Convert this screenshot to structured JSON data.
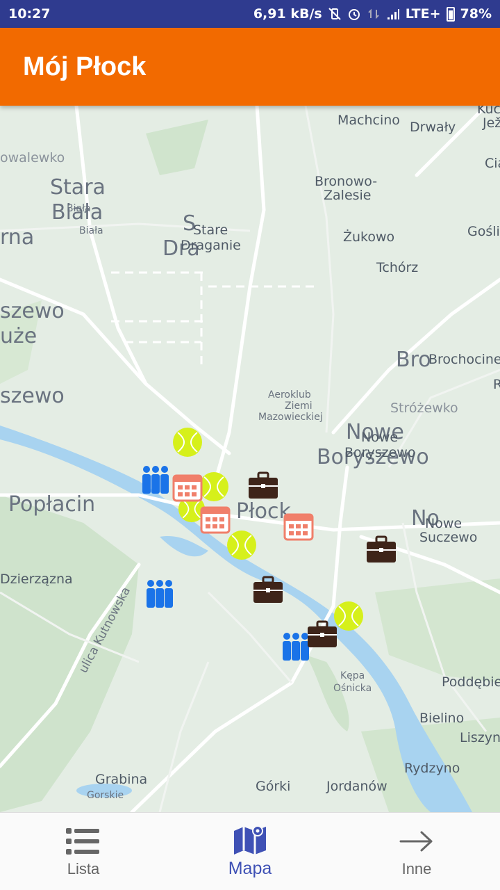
{
  "status_bar": {
    "time": "10:27",
    "speed": "6,91 kB/s",
    "network": "LTE+",
    "battery": "78%"
  },
  "app_bar": {
    "title": "Mój Płock"
  },
  "map": {
    "places": {
      "machcino": "Machcino",
      "drwaly": "Drwały",
      "kuc": "Kuc",
      "jez": "Jež",
      "cia": "Cia",
      "owalewko": "owalewko",
      "stara": "Stara",
      "biala": "Biała",
      "biala_small1": "Biała",
      "biala_small2": "Biała",
      "bronowo": "Bronowo-",
      "zalesie": "Zalesie",
      "s_big": "S",
      "stare": "Stare",
      "dra": "Dra",
      "draganie": "Draganie",
      "rna": "rna",
      "zukowo": "Żukowo",
      "gosli": "Gośli",
      "tchorz": "Tchórz",
      "szewo1": "szewo",
      "uze": "uże",
      "bro": "Bro",
      "brochocine": "Brochocine",
      "r": "R",
      "szewo2": "szewo",
      "aeroklub1": "Aeroklub",
      "aeroklub2": "Ziemi",
      "aeroklub3": "Mazowieckiej",
      "strozewko": "Stróżewko",
      "nowe_big": "Nowe",
      "nowe_small": "Nowe",
      "boryszewo_big": "Boryszewo",
      "boryszewo_small": "Boryszewo",
      "poplacin": "Popłacin",
      "plock": "Płock",
      "no": "No",
      "nowe2": "Nowe",
      "sucz": "Suczewo",
      "dzierzazna": "Dzierzązna",
      "kutnowska": "ulica Kutnowska",
      "kepa1": "Kępa",
      "kepa2": "Ośnicka",
      "poddebie": "Poddębie",
      "bielino": "Bielino",
      "liszyn": "Liszyn",
      "rydzyno": "Rydzyno",
      "grabina": "Grabina",
      "gorskie": "Gorskie",
      "gorki": "Górki",
      "jordanow": "Jordanów"
    }
  },
  "bottom_nav": {
    "items": [
      {
        "label": "Lista",
        "icon": "list-icon"
      },
      {
        "label": "Mapa",
        "icon": "map-icon"
      },
      {
        "label": "Inne",
        "icon": "arrow-right-icon"
      }
    ],
    "active": "Mapa"
  },
  "colors": {
    "status_bar": "#2f3b8f",
    "app_bar": "#f26a00",
    "river": "#a8d3f0",
    "nav_active": "#3f51b5",
    "tennis": "#d6f01b",
    "calendar": "#f07f6a",
    "people": "#1a73e8",
    "briefcase": "#3e2419"
  }
}
